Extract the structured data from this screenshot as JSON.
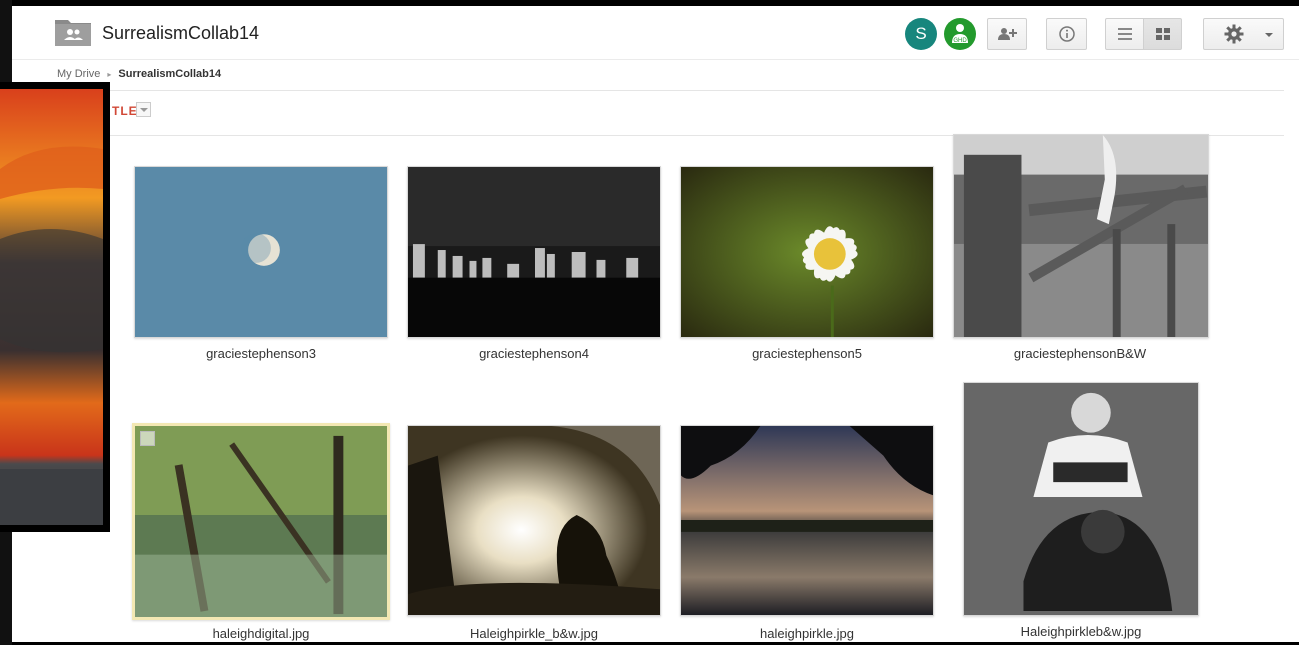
{
  "header": {
    "folder_name": "SurrealismCollab14",
    "avatar_initial": "S",
    "avatar2_initials": "GHD"
  },
  "breadcrumb": {
    "root": "My Drive",
    "separator": "▸",
    "current": "SurrealismCollab14"
  },
  "sort": {
    "label": "TLE"
  },
  "files": [
    {
      "name": "graciestephenson3"
    },
    {
      "name": "graciestephenson4"
    },
    {
      "name": "graciestephenson5"
    },
    {
      "name": "graciestephensonB&W"
    },
    {
      "name": "haleighdigital.jpg"
    },
    {
      "name": "Haleighpirkle_b&w.jpg"
    },
    {
      "name": "haleighpirkle.jpg"
    },
    {
      "name": "Haleighpirkleb&w.jpg"
    }
  ],
  "icons": [
    "folder-shared-icon",
    "person-icon",
    "add-person-icon",
    "info-icon",
    "list-view-icon",
    "grid-view-icon",
    "gear-icon",
    "chevron-down-icon"
  ],
  "colors": {
    "avatar_s": "#17867d",
    "avatar_g": "#239a2d",
    "sort_accent": "#d14836",
    "selected_border": "#f3e8b3"
  }
}
